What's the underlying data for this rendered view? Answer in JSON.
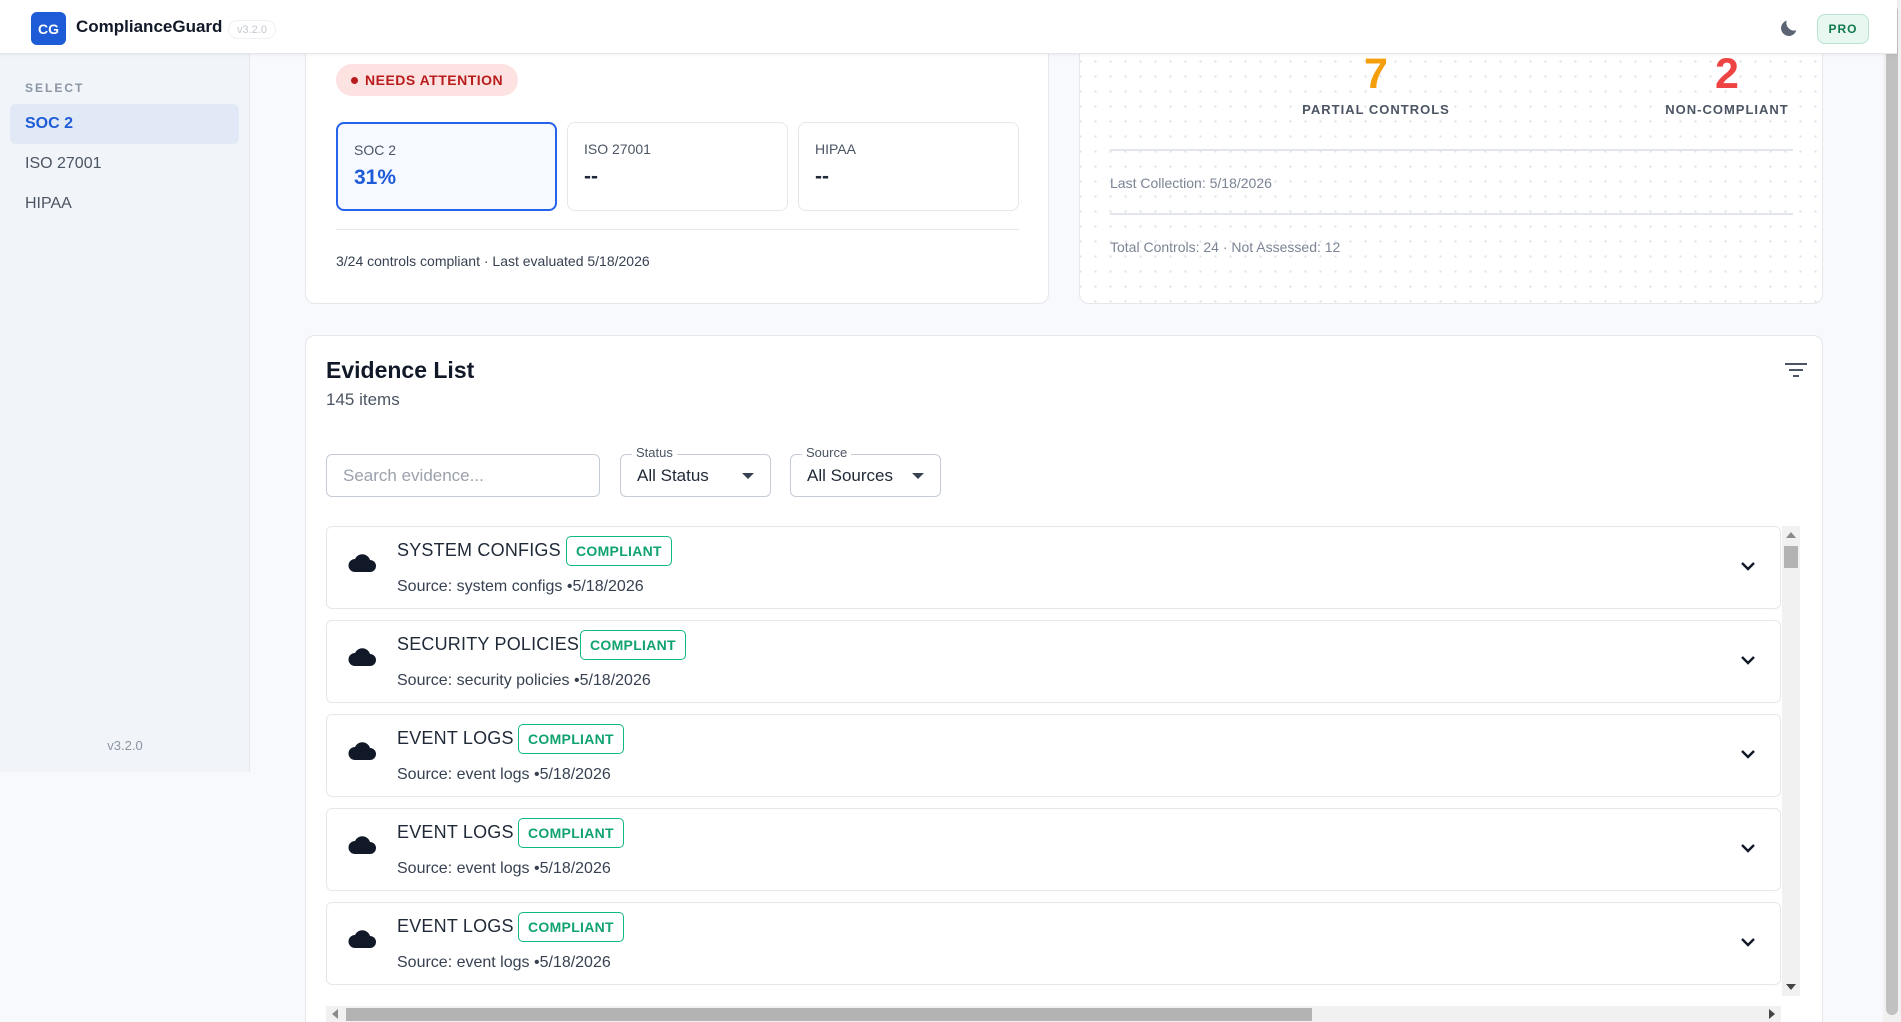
{
  "app": {
    "logo": "CG",
    "name": "ComplianceGuard",
    "version_chip": "v3.2.0",
    "pro_label": "PRO",
    "theme_icon": "moon-icon"
  },
  "sidebar": {
    "heading": "SELECT",
    "items": [
      {
        "label": "SOC 2",
        "active": true
      },
      {
        "label": "ISO 27001",
        "active": false
      },
      {
        "label": "HIPAA",
        "active": false
      }
    ],
    "version": "v3.2.0"
  },
  "overview": {
    "status_badge": "NEEDS ATTENTION",
    "frameworks": [
      {
        "name": "SOC 2",
        "value": "31%",
        "active": true
      },
      {
        "name": "ISO 27001",
        "value": "--",
        "active": false
      },
      {
        "name": "HIPAA",
        "value": "--",
        "active": false
      }
    ],
    "summary": "3/24 controls compliant · Last evaluated 5/18/2026"
  },
  "stats": {
    "partial": {
      "value": "7",
      "label": "PARTIAL CONTROLS",
      "color": "#f59e0b"
    },
    "noncompliant": {
      "value": "2",
      "label": "NON-COMPLIANT",
      "color": "#ef4444"
    },
    "last_collection": "Last Collection: 5/18/2026",
    "totals": "Total Controls: 24 · Not Assessed: 12"
  },
  "evidence": {
    "title": "Evidence List",
    "count": "145 items",
    "search_placeholder": "Search evidence...",
    "status_filter": {
      "label": "Status",
      "value": "All Status"
    },
    "source_filter": {
      "label": "Source",
      "value": "All Sources"
    },
    "rows": [
      {
        "title": "SYSTEM CONFIGS",
        "badge": "COMPLIANT",
        "source": "Source: system configs •5/18/2026"
      },
      {
        "title": "SECURITY POLICIES",
        "badge": "COMPLIANT",
        "source": "Source: security policies •5/18/2026"
      },
      {
        "title": "EVENT LOGS",
        "badge": "COMPLIANT",
        "source": "Source: event logs •5/18/2026"
      },
      {
        "title": "EVENT LOGS",
        "badge": "COMPLIANT",
        "source": "Source: event logs •5/18/2026"
      },
      {
        "title": "EVENT LOGS",
        "badge": "COMPLIANT",
        "source": "Source: event logs •5/18/2026"
      }
    ]
  }
}
